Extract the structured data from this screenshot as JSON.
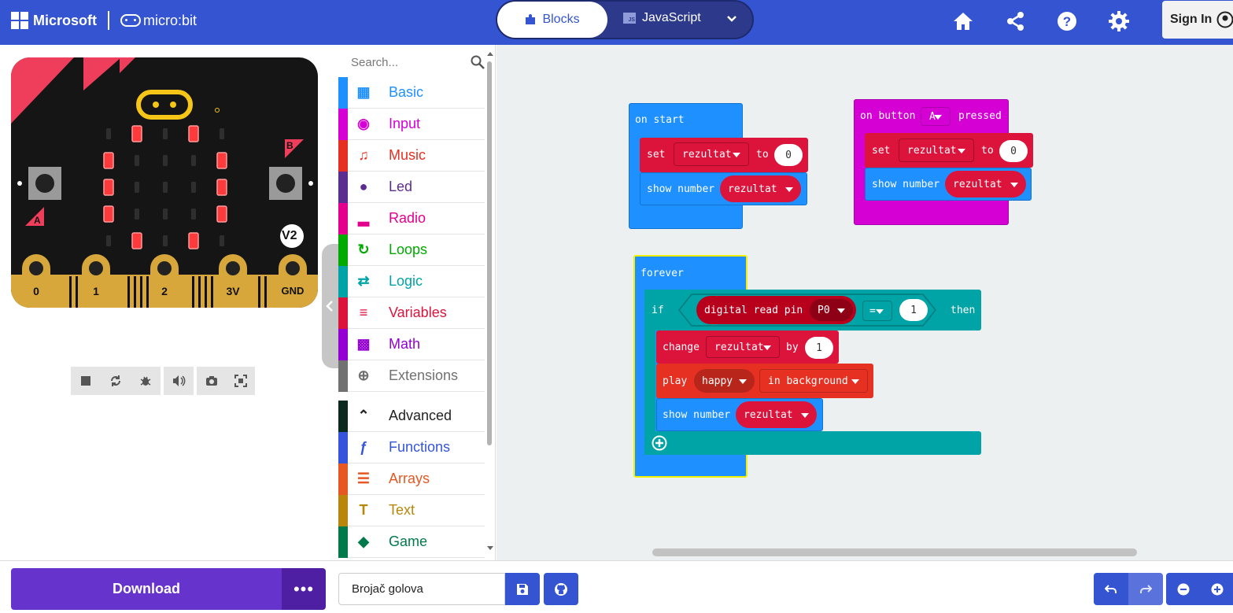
{
  "header": {
    "brand": "Microsoft",
    "product": "micro:bit",
    "tabs": [
      {
        "label": "Blocks",
        "active": true
      },
      {
        "label": "JavaScript",
        "active": false
      }
    ],
    "js_icon_text": "JS",
    "signin_label": "Sign In",
    "icons": [
      "home-icon",
      "share-icon",
      "help-icon",
      "settings-icon"
    ],
    "color": "#3454d1"
  },
  "simulator": {
    "board_labels": {
      "a": "A",
      "b": "B",
      "version": "V2"
    },
    "pins": [
      "0",
      "1",
      "2",
      "3V",
      "GND"
    ],
    "led_on": [
      [
        0,
        1,
        0,
        1,
        0
      ],
      [
        1,
        0,
        0,
        0,
        1
      ],
      [
        1,
        0,
        0,
        0,
        1
      ],
      [
        1,
        0,
        0,
        0,
        1
      ],
      [
        0,
        1,
        0,
        1,
        0
      ]
    ],
    "controls": [
      "stop-icon",
      "restart-icon",
      "debug-icon",
      "sound-icon",
      "screenshot-icon",
      "fullscreen-icon"
    ]
  },
  "toolbox": {
    "search_placeholder": "Search...",
    "categories": [
      {
        "label": "Basic",
        "color": "#1e90ff"
      },
      {
        "label": "Input",
        "color": "#d400d4"
      },
      {
        "label": "Music",
        "color": "#e63022"
      },
      {
        "label": "Led",
        "color": "#5c2d91"
      },
      {
        "label": "Radio",
        "color": "#e3008c"
      },
      {
        "label": "Loops",
        "color": "#00aa00"
      },
      {
        "label": "Logic",
        "color": "#00a4a6"
      },
      {
        "label": "Variables",
        "color": "#dc143c"
      },
      {
        "label": "Math",
        "color": "#9400d3"
      },
      {
        "label": "Extensions",
        "color": "#717171"
      }
    ],
    "advanced": {
      "label": "Advanced",
      "color": "#0b2a1f"
    },
    "advanced_categories": [
      {
        "label": "Functions",
        "color": "#3455db"
      },
      {
        "label": "Arrays",
        "color": "#e65722"
      },
      {
        "label": "Text",
        "color": "#b8860b"
      },
      {
        "label": "Game",
        "color": "#007a4b"
      }
    ]
  },
  "workspace": {
    "on_start": {
      "label": "on start",
      "set": {
        "kw": "set",
        "var": "rezultat",
        "to": "to",
        "value": "0"
      },
      "show": {
        "kw": "show number",
        "var": "rezultat"
      }
    },
    "on_button": {
      "prefix": "on button",
      "button": "A",
      "suffix": "pressed",
      "set": {
        "kw": "set",
        "var": "rezultat",
        "to": "to",
        "value": "0"
      },
      "show": {
        "kw": "show number",
        "var": "rezultat"
      }
    },
    "forever": {
      "label": "forever",
      "if_kw": "if",
      "read": "digital read pin",
      "pin": "P0",
      "op": "=",
      "compare": "1",
      "then_kw": "then",
      "change": {
        "kw": "change",
        "var": "rezultat",
        "by": "by",
        "value": "1"
      },
      "play": {
        "kw": "play",
        "sound": "happy",
        "mode": "in background"
      },
      "show": {
        "kw": "show number",
        "var": "rezultat"
      }
    }
  },
  "footer": {
    "download_label": "Download",
    "more_label": "•••",
    "project_name": "Brojač golova"
  }
}
